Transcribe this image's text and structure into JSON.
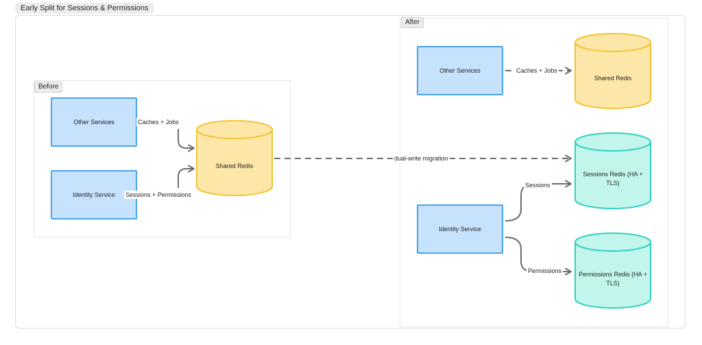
{
  "title": "Early Split for Sessions & Permissions",
  "groups": {
    "before": "Before",
    "after": "After"
  },
  "before": {
    "other_services": "Other Services",
    "identity_service": "Identity Service",
    "shared_redis": "Shared Redis",
    "edge_caches_jobs": "Caches + Jobs",
    "edge_sessions_permissions": "Sessions + Permissions"
  },
  "after": {
    "other_services": "Other Services",
    "identity_service": "Identity Service",
    "shared_redis": "Shared Redis",
    "sessions_redis": "Sessions Redis (HA + TLS)",
    "permissions_redis": "Permissions Redis (HA + TLS)",
    "edge_caches_jobs": "Caches + Jobs",
    "edge_sessions": "Sessions",
    "edge_permissions": "Permissions"
  },
  "migration_label": "dual-write migration",
  "colors": {
    "service_fill": "#c6e2fd",
    "service_stroke": "#4aa4e6",
    "shared_fill": "#fde7a8",
    "shared_stroke": "#f3c332",
    "ha_fill": "#c2f5ec",
    "ha_stroke": "#2fd1bf",
    "edge": "#6b6b6b"
  }
}
